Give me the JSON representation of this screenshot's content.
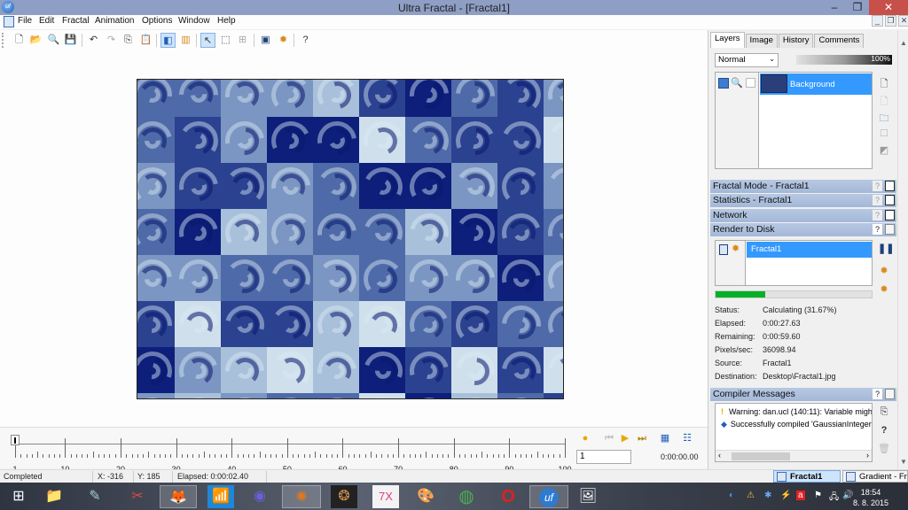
{
  "window": {
    "title": "Ultra Fractal - [Fractal1]",
    "app_icon": "uf",
    "minimize": "–",
    "maximize": "❐",
    "close": "✕"
  },
  "menu": [
    "File",
    "Edit",
    "Fractal",
    "Animation",
    "Options",
    "Window",
    "Help"
  ],
  "mdi_buttons": [
    "_",
    "❐",
    "✕"
  ],
  "toolbar": {
    "buttons": [
      {
        "name": "new-icon",
        "glyph": "🗋"
      },
      {
        "name": "open-icon",
        "glyph": "📂"
      },
      {
        "name": "browse-icon",
        "glyph": "🔍"
      },
      {
        "name": "save-icon",
        "glyph": "💾"
      },
      {
        "name": "undo-icon",
        "glyph": "↶"
      },
      {
        "name": "redo-icon",
        "glyph": "↷"
      },
      {
        "name": "copy-icon",
        "glyph": "⎘"
      },
      {
        "name": "paste-icon",
        "glyph": "📋"
      },
      {
        "name": "fractal-window-icon",
        "glyph": "◧"
      },
      {
        "name": "gradient-window-icon",
        "glyph": "▥"
      },
      {
        "name": "select-arrow-icon",
        "glyph": "↖"
      },
      {
        "name": "zoom-select-icon",
        "glyph": "⬚"
      },
      {
        "name": "move-icon",
        "glyph": "⊞"
      },
      {
        "name": "render-to-disk-icon",
        "glyph": "▣"
      },
      {
        "name": "gear-icon",
        "glyph": "✹"
      },
      {
        "name": "help-icon",
        "glyph": "?"
      }
    ]
  },
  "layers_panel": {
    "tabs": [
      "Layers",
      "Image",
      "History",
      "Comments"
    ],
    "active_tab": "Layers",
    "blend_mode": "Normal",
    "opacity": "100%",
    "layers": [
      {
        "name": "Background",
        "selected": true
      }
    ]
  },
  "panels": [
    {
      "title": "Fractal Mode - Fractal1",
      "help": "?"
    },
    {
      "title": "Statistics - Fractal1",
      "help": "?"
    },
    {
      "title": "Network",
      "help": "?"
    },
    {
      "title": "Render to Disk",
      "help": "?"
    }
  ],
  "render_to_disk": {
    "items": [
      {
        "name": "Fractal1",
        "selected": true
      }
    ],
    "progress_percent": 31.67,
    "stats": [
      {
        "label": "Status:",
        "value": "Calculating (31.67%)"
      },
      {
        "label": "Elapsed:",
        "value": "0:00:27.63"
      },
      {
        "label": "Remaining:",
        "value": "0:00:59.60"
      },
      {
        "label": "Pixels/sec:",
        "value": "36098.94"
      },
      {
        "label": "Source:",
        "value": "Fractal1"
      },
      {
        "label": "Destination:",
        "value": "Desktop\\Fractal1.jpg"
      }
    ]
  },
  "compiler": {
    "title": "Compiler Messages",
    "help": "?",
    "messages": [
      {
        "type": "warning",
        "icon": "!",
        "text": "Warning: dan.ucl (140:11): Variable migh"
      },
      {
        "type": "info",
        "icon": "◆",
        "text": "Successfully compiled 'GaussianInteger'"
      }
    ]
  },
  "timeline": {
    "labels": [
      "1",
      "10",
      "20",
      "30",
      "40",
      "50",
      "60",
      "70",
      "80",
      "90",
      "100"
    ],
    "frame": "1",
    "time": "0:00:00.00",
    "range": [
      1,
      100
    ],
    "current_frame": 1
  },
  "statusbar": {
    "status": "Completed",
    "x": "X: -316",
    "y": "Y: 185",
    "elapsed": "Elapsed: 0:00:02.40"
  },
  "doc_tabs": [
    {
      "label": "Fractal1",
      "active": true
    },
    {
      "label": "Gradient - Fr...",
      "active": false
    }
  ],
  "taskbar": {
    "apps": [
      {
        "name": "windows-start-icon",
        "glyph": "⊞"
      },
      {
        "name": "file-explorer-icon",
        "glyph": "📁"
      },
      {
        "name": "notepad-icon",
        "glyph": "✎"
      },
      {
        "name": "snipping-tool-icon",
        "glyph": "✂"
      },
      {
        "name": "firefox-icon",
        "glyph": "🦊"
      },
      {
        "name": "wifi-app-icon",
        "glyph": "📶"
      },
      {
        "name": "apophysis-icon",
        "glyph": "◉"
      },
      {
        "name": "fractal-app-icon",
        "glyph": "✺"
      },
      {
        "name": "mandelbulb-icon",
        "glyph": "❂"
      },
      {
        "name": "7x-icon",
        "glyph": "7X"
      },
      {
        "name": "paint-icon",
        "glyph": "🎨"
      },
      {
        "name": "chrome-icon",
        "glyph": "◍"
      },
      {
        "name": "opera-icon",
        "glyph": "O"
      },
      {
        "name": "ultra-fractal-icon",
        "glyph": "uf"
      },
      {
        "name": "image-editor-icon",
        "glyph": "🖼"
      }
    ],
    "tray_icons": [
      "◐",
      "⚠",
      "✱",
      "⚡",
      "a",
      "⚑",
      "🖧",
      "🔊"
    ],
    "time": "18:54",
    "date": "8. 8. 2015"
  },
  "fractal_palette": [
    "#0d1f7a",
    "#2b4290",
    "#4f6aa8",
    "#7b96c2",
    "#a9c0da",
    "#cfe0ec"
  ]
}
